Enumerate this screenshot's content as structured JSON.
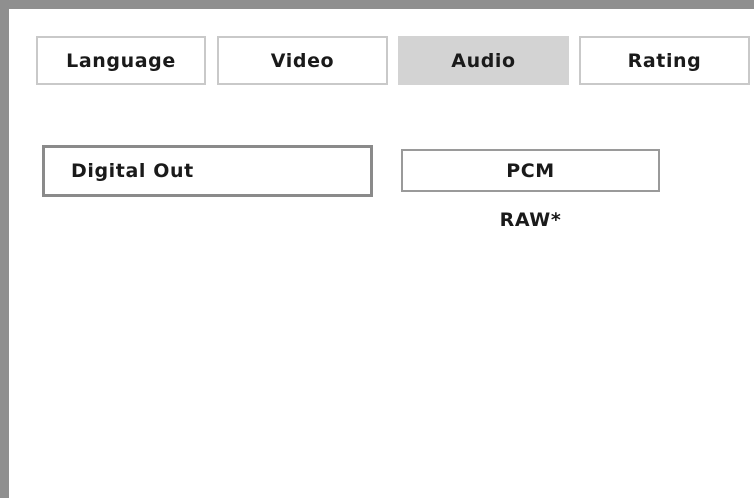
{
  "tabs": [
    {
      "label": "Language",
      "active": false
    },
    {
      "label": "Video",
      "active": false
    },
    {
      "label": "Audio",
      "active": true
    },
    {
      "label": "Rating",
      "active": false
    }
  ],
  "setting": {
    "label": "Digital Out",
    "options": [
      "PCM",
      "RAW*"
    ],
    "highlighted_option": "PCM"
  },
  "colors": {
    "frame": "#8f8f8f",
    "active_tab": "#d3d3d3",
    "tab_border": "#c9c9c9",
    "text": "#1a1a1a"
  }
}
